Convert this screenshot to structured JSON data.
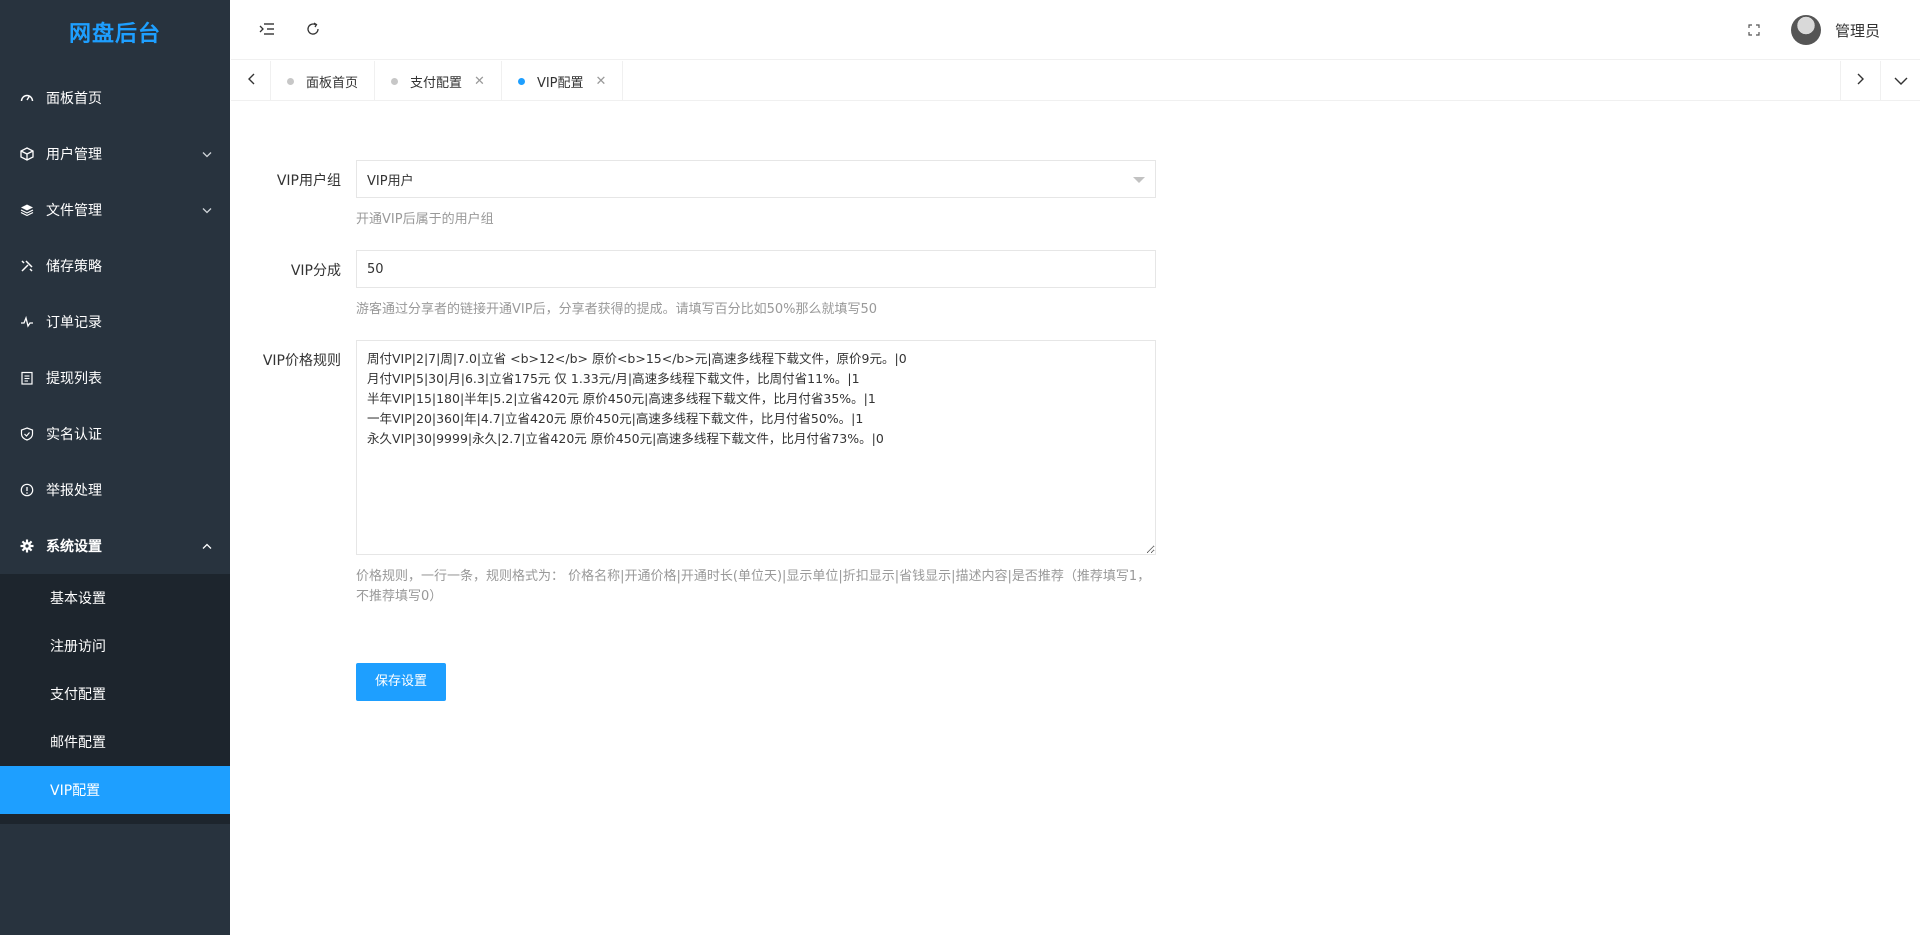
{
  "app": {
    "title": "网盘后台"
  },
  "sidebar": {
    "items": [
      {
        "label": "面板首页",
        "icon": "dashboard-icon"
      },
      {
        "label": "用户管理",
        "icon": "cube-icon"
      },
      {
        "label": "文件管理",
        "icon": "layers-icon"
      },
      {
        "label": "储存策略",
        "icon": "tools-icon"
      },
      {
        "label": "订单记录",
        "icon": "pulse-icon"
      },
      {
        "label": "提现列表",
        "icon": "clipboard-icon"
      },
      {
        "label": "实名认证",
        "icon": "shield-icon"
      },
      {
        "label": "举报处理",
        "icon": "info-icon"
      },
      {
        "label": "系统设置",
        "icon": "gear-icon"
      }
    ],
    "sub_items": [
      {
        "label": "基本设置"
      },
      {
        "label": "注册访问"
      },
      {
        "label": "支付配置"
      },
      {
        "label": "邮件配置"
      },
      {
        "label": "VIP配置"
      }
    ]
  },
  "header": {
    "user_name": "管理员"
  },
  "tabs": [
    {
      "label": "面板首页"
    },
    {
      "label": "支付配置"
    },
    {
      "label": "VIP配置"
    }
  ],
  "form": {
    "vip_group": {
      "label": "VIP用户组",
      "value": "VIP用户",
      "hint": "开通VIP后属于的用户组"
    },
    "vip_share": {
      "label": "VIP分成",
      "value": "50",
      "hint": "游客通过分享者的链接开通VIP后，分享者获得的提成。请填写百分比如50%那么就填写50"
    },
    "vip_price_rules": {
      "label": "VIP价格规则",
      "value": "周付VIP|2|7|周|7.0|立省 <b>12</b> 原价<b>15</b>元|高速多线程下载文件，原价9元。|0\n月付VIP|5|30|月|6.3|立省175元 仅 1.33元/月|高速多线程下载文件，比周付省11%。|1\n半年VIP|15|180|半年|5.2|立省420元 原价450元|高速多线程下载文件，比月付省35%。|1\n一年VIP|20|360|年|4.7|立省420元 原价450元|高速多线程下载文件，比月付省50%。|1\n永久VIP|30|9999|永久|2.7|立省420元 原价450元|高速多线程下载文件，比月付省73%。|0",
      "hint": "价格规则，一行一条，规则格式为： 价格名称|开通价格|开通时长(单位天)|显示单位|折扣显示|省钱显示|描述内容|是否推荐（推荐填写1，不推荐填写0）"
    },
    "save_label": "保存设置"
  }
}
